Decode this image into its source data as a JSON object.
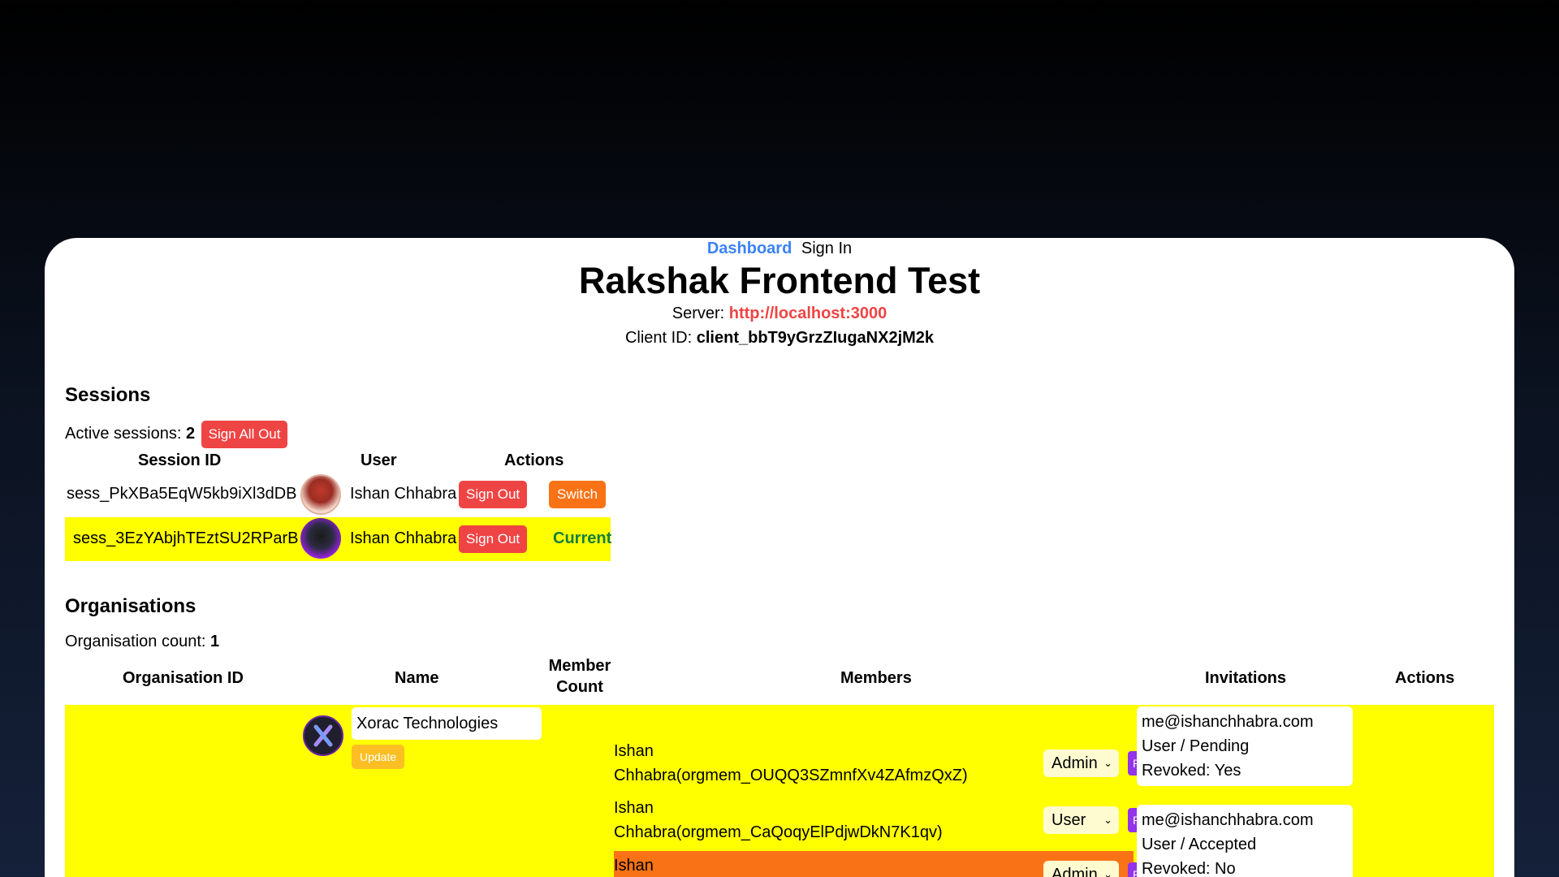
{
  "nav": {
    "dashboard": "Dashboard",
    "signin": "Sign In"
  },
  "title": "Rakshak Frontend Test",
  "server": {
    "label": "Server:",
    "value": "http://localhost:3000"
  },
  "client": {
    "label": "Client ID:",
    "value": "client_bbT9yGrzZIugaNX2jM2k"
  },
  "sessions": {
    "heading": "Sessions",
    "active_label": "Active sessions:",
    "active_count": "2",
    "sign_all_out": "Sign All Out",
    "headers": {
      "session_id": "Session ID",
      "user": "User",
      "actions": "Actions"
    },
    "rows": [
      {
        "id": "sess_PkXBa5EqW5kb9iXl3dDB",
        "user": "Ishan Chhabra",
        "signout": "Sign Out",
        "action": "Switch"
      },
      {
        "id": "sess_3EzYAbjhTEztSU2RParB",
        "user": "Ishan Chhabra",
        "signout": "Sign Out",
        "action": "Current"
      }
    ]
  },
  "orgs": {
    "heading": "Organisations",
    "count_label": "Organisation count:",
    "count": "1",
    "headers": {
      "org_id": "Organisation ID",
      "name": "Name",
      "member_count_1": "Member",
      "member_count_2": "Count",
      "members": "Members",
      "invitations": "Invitations",
      "actions": "Actions"
    },
    "org": {
      "name": "Xorac Technologies",
      "update": "Update",
      "members": [
        {
          "line1": "Ishan",
          "line2": "Chhabra(orgmem_OUQQ3SZmnfXv4ZAfmzQxZ)",
          "role": "Admin",
          "remove": "Remove"
        },
        {
          "line1": "Ishan",
          "line2": "Chhabra(orgmem_CaQoqyElPdjwDkN7K1qv)",
          "role": "User",
          "remove": "Remove"
        },
        {
          "line1": "Ishan",
          "line2": "",
          "role": "Admin",
          "remove": "Remove"
        }
      ],
      "invitations": [
        {
          "email": "me@ishanchhabra.com",
          "status": "User / Pending",
          "revoked": "Revoked: Yes"
        },
        {
          "email": "me@ishanchhabra.com",
          "status": "User / Accepted",
          "revoked": "Revoked: No"
        }
      ]
    }
  },
  "colors": {
    "highlight": "#ffff00",
    "orange_row": "#f97316",
    "link": "#3b82f6",
    "server": "#ef4444"
  }
}
